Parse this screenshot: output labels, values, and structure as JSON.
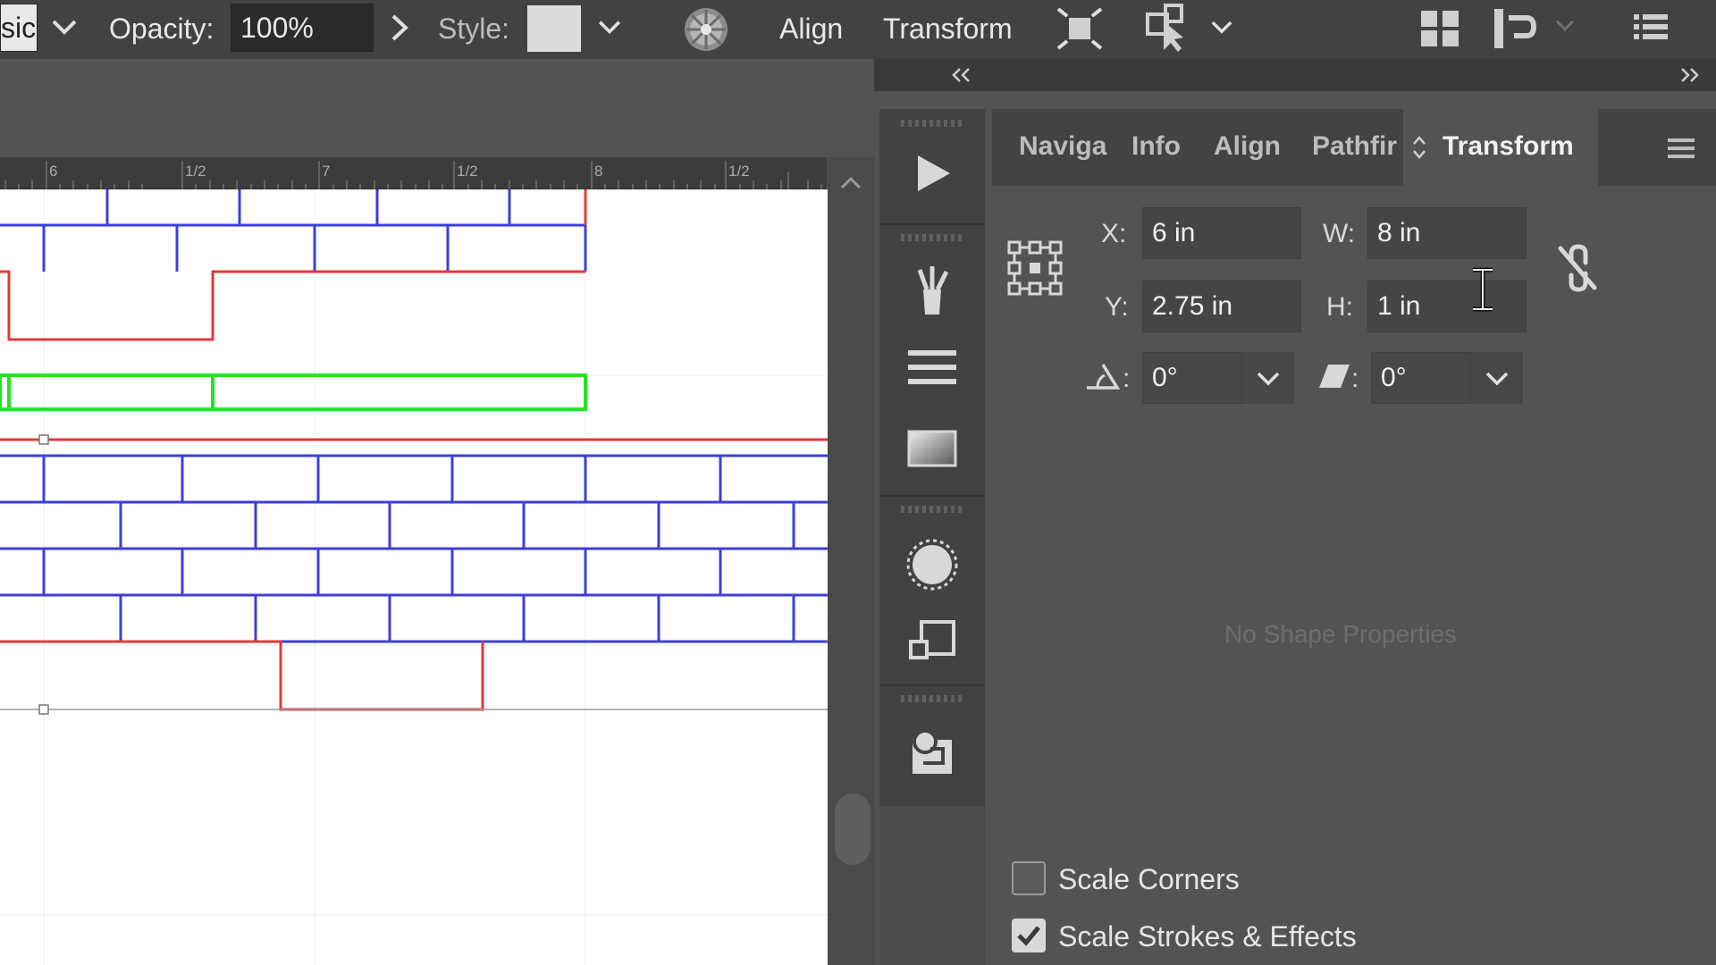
{
  "toolbar": {
    "basic_label": "sic",
    "opacity_label": "Opacity:",
    "opacity_value": "100%",
    "style_label": "Style:",
    "align_label": "Align",
    "transform_label": "Transform"
  },
  "ruler": {
    "ticks": [
      "6",
      "1/2",
      "7",
      "1/2",
      "8",
      "1/2"
    ]
  },
  "panel": {
    "tabs": [
      "Naviga",
      "Info",
      "Align",
      "Pathfir",
      "Transform"
    ],
    "active_tab": "Transform",
    "x_label": "X:",
    "x_value": "6 in",
    "y_label": "Y:",
    "y_value": "2.75 in",
    "w_label": "W:",
    "w_value": "8 in",
    "h_label": "H:",
    "h_value": "1 in",
    "angle_value": "0°",
    "shear_value": "0°",
    "no_shape": "No Shape Properties",
    "scale_corners": "Scale Corners",
    "scale_corners_checked": false,
    "scale_strokes": "Scale Strokes & Effects",
    "scale_strokes_checked": true
  },
  "colors": {
    "red": "#e03a3a",
    "blue": "#3d3fd8",
    "green": "#22e622",
    "accent_panel": "#535353"
  }
}
